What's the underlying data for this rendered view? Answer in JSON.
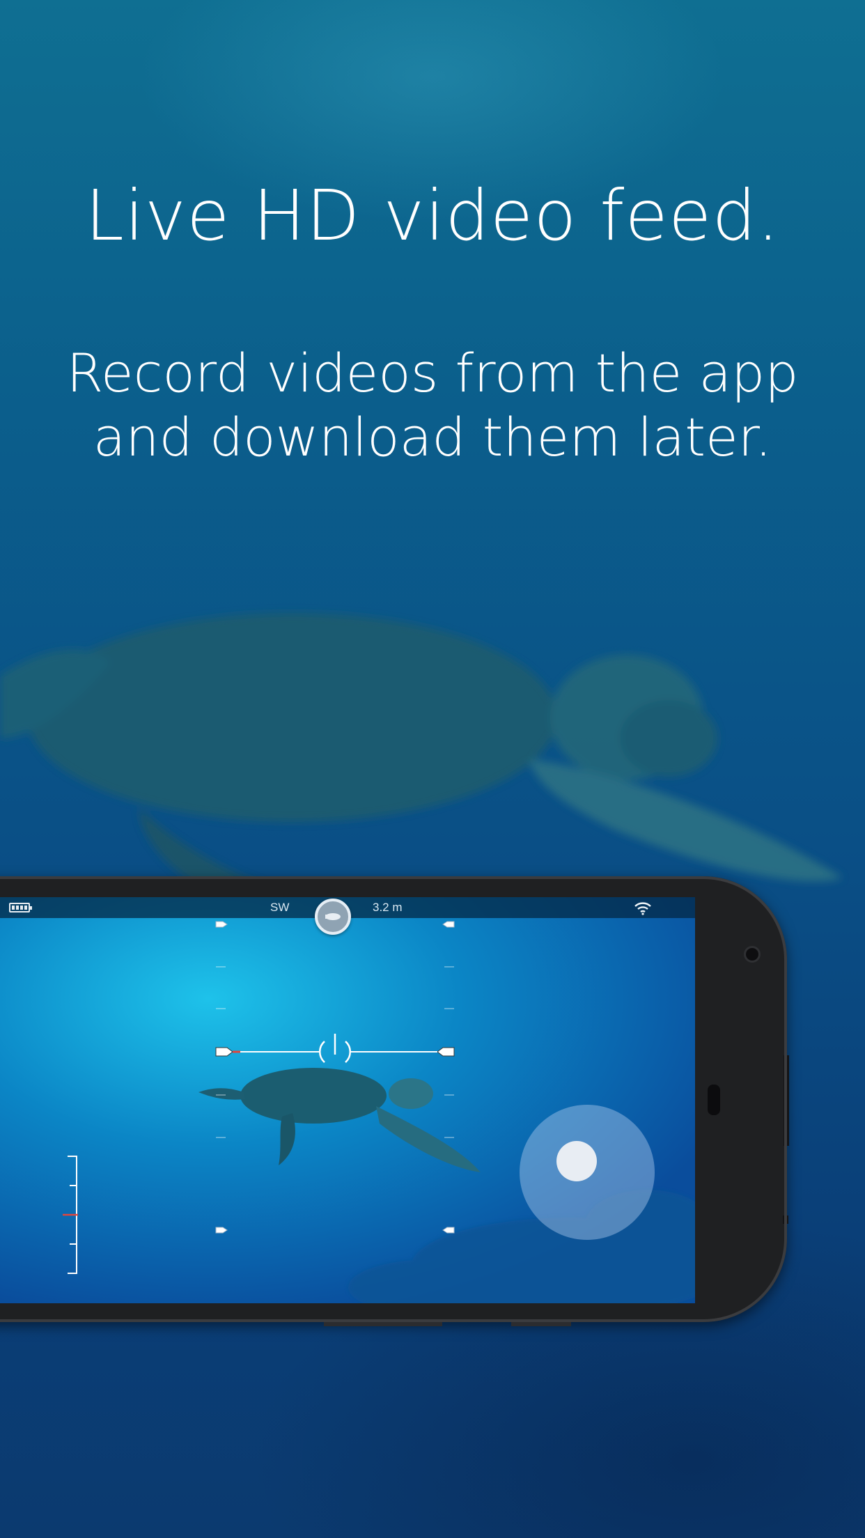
{
  "headline": "Live HD video feed.",
  "subline": {
    "line1": "Record videos from the app",
    "line2": "and download them later."
  },
  "status_bar": {
    "heading": "SW",
    "depth": "3.2 m"
  },
  "icons": {
    "battery": "battery-icon",
    "wifi": "wifi-icon",
    "compass": "compass-knob-icon",
    "joystick": "joystick-icon"
  },
  "colors": {
    "text": "#ffffff",
    "hud": "#ffffff",
    "depth_marker": "#e2453c"
  }
}
